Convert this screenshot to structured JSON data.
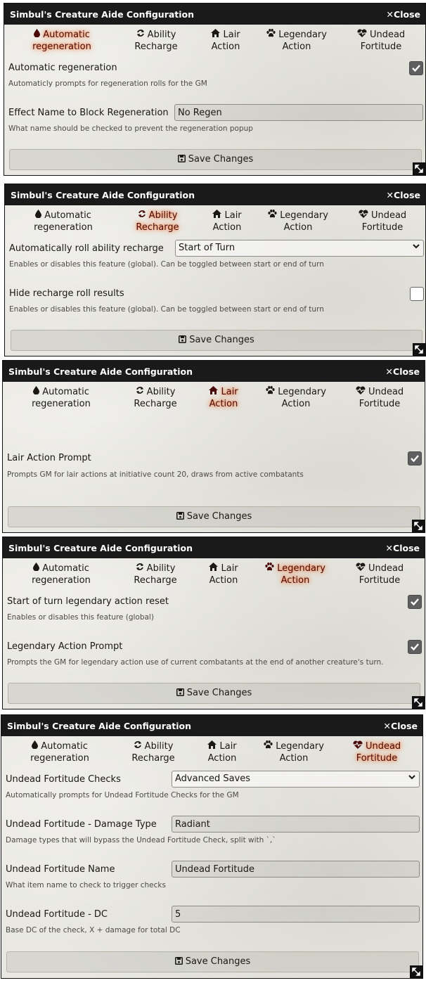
{
  "title": "Simbul's Creature Aide Configuration",
  "close_label": "Close",
  "save_label": "Save Changes",
  "tabs": [
    {
      "line1": "Automatic",
      "line2": "regeneration",
      "icon": "droplet-icon"
    },
    {
      "line1": "Ability",
      "line2": "Recharge",
      "icon": "sync-icon"
    },
    {
      "line1": "Lair",
      "line2": "Action",
      "icon": "home-icon"
    },
    {
      "line1": "Legendary",
      "line2": "Action",
      "icon": "paw-icon"
    },
    {
      "line1": "Undead",
      "line2": "Fortitude",
      "icon": "heartbeat-icon"
    }
  ],
  "colors": {
    "titlebar": "#1a1a1a",
    "active_tab_glow": "#ff6400",
    "active_tab_text": "#4b0a0a",
    "checkbox_checked": "#5f5f5f"
  },
  "panels": [
    {
      "active_tab": "Automatic regeneration",
      "settings": [
        {
          "label": "Automatic regeneration",
          "hint": "Automaticly prompts for regeneration rolls for the GM",
          "control": "checkbox",
          "checked": true
        },
        {
          "label": "Effect Name to Block Regeneration",
          "hint": "What name should be checked to prevent the regeneration popup",
          "control": "text",
          "value": "No Regen"
        }
      ]
    },
    {
      "active_tab": "Ability Recharge",
      "settings": [
        {
          "label": "Automatically roll ability recharge",
          "hint": "Enables or disables this feature (global). Can be toggled between start or end of turn",
          "control": "select",
          "value": "Start of Turn"
        },
        {
          "label": "Hide recharge roll results",
          "hint": "Enables or disables this feature (global). Can be toggled between start or end of turn",
          "control": "checkbox",
          "checked": false
        }
      ]
    },
    {
      "active_tab": "Lair Action",
      "settings": [
        {
          "label": "Lair Action Prompt",
          "hint": "Prompts GM for lair actions at initiative count 20, draws from active combatants",
          "control": "checkbox",
          "checked": true
        }
      ]
    },
    {
      "active_tab": "Legendary Action",
      "settings": [
        {
          "label": "Start of turn legendary action reset",
          "hint": "Enables or disables this feature (global)",
          "control": "checkbox",
          "checked": true
        },
        {
          "label": "Legendary Action Prompt",
          "hint": "Prompts the GM for legendary action use of current combatants at the end of another creature's turn.",
          "control": "checkbox",
          "checked": true
        }
      ]
    },
    {
      "active_tab": "Undead Fortitude",
      "settings": [
        {
          "label": "Undead Fortitude Checks",
          "hint": "Automatically prompts for Undead Fortitude Checks for the GM",
          "control": "select",
          "value": "Advanced Saves"
        },
        {
          "label": "Undead Fortitude - Damage Type",
          "hint": "Damage types that will bypass the Undead Fortitude Check, split with `,`",
          "control": "text",
          "value": "Radiant"
        },
        {
          "label": "Undead Fortitude Name",
          "hint": "What item name to check to trigger checks",
          "control": "text",
          "value": "Undead Fortitude"
        },
        {
          "label": "Undead Fortitude - DC",
          "hint": "Base DC of the check, X + damage for total DC",
          "control": "text",
          "value": "5"
        }
      ]
    }
  ]
}
